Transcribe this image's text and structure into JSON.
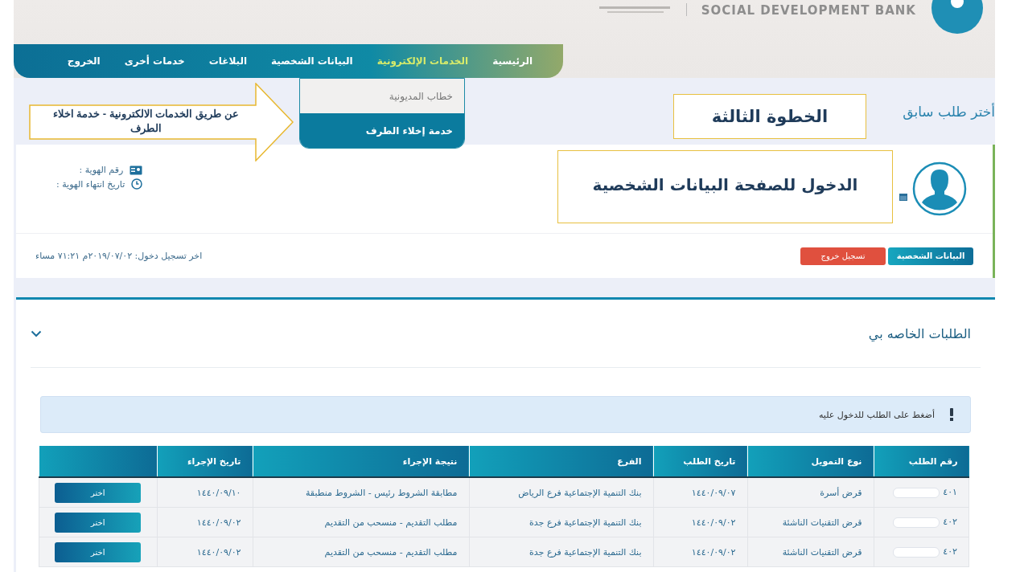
{
  "header": {
    "bank_name": "SOCIAL DEVELOPMENT BANK"
  },
  "nav": {
    "items": [
      {
        "label": "الرئيسية",
        "selected": false
      },
      {
        "label": "الخدمات الإلكترونية",
        "selected": true
      },
      {
        "label": "البيانات الشخصية",
        "selected": false
      },
      {
        "label": "البلاغات",
        "selected": false
      },
      {
        "label": "خدمات أخرى",
        "selected": false
      },
      {
        "label": "الخروج",
        "selected": false
      }
    ]
  },
  "dropdown": {
    "items": [
      {
        "label": "خطاب المديونية",
        "selected": false
      },
      {
        "label": "خدمة إخلاء الطرف",
        "selected": true
      }
    ]
  },
  "previous_request_link": "أختر طلب سابق",
  "annotations": {
    "arrow_note": "عن طريق الخدمات الالكترونية - خدمة اخلاء الطرف",
    "step": "الخطوة الثالثة",
    "profile_note": "الدخول للصفحة البيانات الشخصية"
  },
  "profile": {
    "fields": [
      {
        "kind": "id",
        "label": "رقم الهوية :"
      },
      {
        "kind": "expiry",
        "label": "تاريخ انتهاء الهوية :"
      }
    ],
    "buttons": [
      {
        "kind": "primary",
        "label": "البيانات الشخصية"
      },
      {
        "kind": "danger",
        "label": "تسجيل خروج"
      }
    ],
    "last_login": "اخر تسجيل دخول: ٢٠١٩/٠٧/٠٢م ٧١:٢١ مساء"
  },
  "requests": {
    "title": "الطلبات الخاصه بي",
    "expanded": true,
    "alert": "أضغط على الطلب للدخول عليه",
    "table": {
      "columns": [
        "رقم الطلب",
        "نوع التمويل",
        "تاريخ الطلب",
        "الفرع",
        "نتيجة الإجراء",
        "تاريخ الإجراء"
      ],
      "rows": [
        {
          "number": "٤٠١",
          "type": "قرض أسرة",
          "date": "١٤٤٠/٠٩/٠٧",
          "branch": "بنك التنمية الإجتماعية فرع الرياض",
          "result": "مطابقة الشروط رئيس - الشروط منطبقة",
          "action_date": "١٤٤٠/٠٩/١٠",
          "button": "اختر"
        },
        {
          "number": "٤٠٢",
          "type": "قرض التقنيات الناشئة",
          "date": "١٤٤٠/٠٩/٠٢",
          "branch": "بنك التنمية الإجتماعية فرع جدة",
          "result": "مطلب التقديم - منسحب من التقديم",
          "action_date": "١٤٤٠/٠٩/٠٢",
          "button": "اختر"
        },
        {
          "number": "٤٠٢",
          "type": "قرض التقنيات الناشئة",
          "date": "١٤٤٠/٠٩/٠٢",
          "branch": "بنك التنمية الإجتماعية فرع جدة",
          "result": "مطلب التقديم - منسحب من التقديم",
          "action_date": "١٤٤٠/٠٩/٠٢",
          "button": "اختر"
        }
      ]
    }
  }
}
